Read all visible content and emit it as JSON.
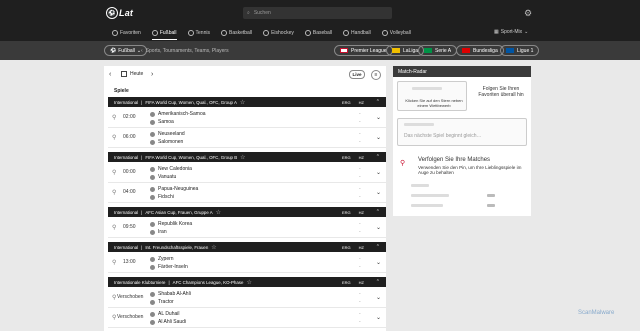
{
  "header": {
    "logo_text": "Lat",
    "search_placeholder": "Suchen",
    "sports": [
      {
        "label": "Favoriten"
      },
      {
        "label": "Fußball"
      },
      {
        "label": "Tennis"
      },
      {
        "label": "Basketball"
      },
      {
        "label": "Eishockey"
      },
      {
        "label": "Baseball"
      },
      {
        "label": "Handball"
      },
      {
        "label": "Volleyball"
      }
    ],
    "more_label": "Sport-Mix"
  },
  "subbar": {
    "sport_select": "Fußball",
    "breadcrumb": "Sports, Tournaments, Teams, Players",
    "leagues": [
      {
        "label": "Premier League",
        "flag": "#c8102e"
      },
      {
        "label": "LaLiga",
        "flag": "#f1bf00"
      },
      {
        "label": "Serie A",
        "flag": "#009246"
      },
      {
        "label": "Bundesliga",
        "flag": "#dd0000"
      },
      {
        "label": "Ligue 1",
        "flag": "#0055a4"
      }
    ]
  },
  "main": {
    "date_label": "Heute",
    "live_label": "Live",
    "section_label": "Spiele",
    "col_erg": "ERG",
    "col_hz": "HZ",
    "leagues": [
      {
        "category": "International",
        "name": "FIFA World Cup, Women, Qual., OFC, Group A"
      },
      {
        "category": "International",
        "name": "FIFA World Cup, Women, Qual., OFC, Group B"
      },
      {
        "category": "International",
        "name": "AFC Asian Cup, Frauen, Gruppe A"
      },
      {
        "category": "International",
        "name": "Int. Freundschaftsspiele, Frauen"
      },
      {
        "category": "Internationale Klubturniere",
        "name": "AFC Champions League, KO-Phase"
      }
    ],
    "matches": [
      {
        "time": "02:00",
        "home": "Amerikanisch-Samoa",
        "away": "Samoa"
      },
      {
        "time": "06:00",
        "home": "Neuseeland",
        "away": "Salomonen"
      },
      {
        "time": "00:00",
        "home": "New Caledonia",
        "away": "Vanuatu"
      },
      {
        "time": "04:00",
        "home": "Papua-Neuguinea",
        "away": "Fidschi"
      },
      {
        "time": "09:50",
        "home": "Republik Korea",
        "away": "Iran"
      },
      {
        "time": "13:00",
        "home": "Zypern",
        "away": "Färöer-Inseln"
      },
      {
        "time": "Verschoben",
        "home": "Shabab Al-Ahli",
        "away": "Tractor"
      },
      {
        "time": "Verschoben",
        "home": "AL Duhail",
        "away": "Al Ahli Saudi"
      }
    ],
    "dash": "-"
  },
  "sidebar": {
    "title": "Match-Radar",
    "card1_hint": "Klicken Sie auf den Stern neben einem Wettbewerb",
    "card1_side": "Folgen Sie Ihren Favoriten überall hin",
    "card2_hint": "Das nächste Spiel beginnt gleich…",
    "card3_title": "Verfolgen Sie Ihre Matches",
    "card3_body": "Verwenden Sie den Pin, um Ihre Lieblingsspiele im Auge zu behalten"
  },
  "watermark": "ScanMalware"
}
